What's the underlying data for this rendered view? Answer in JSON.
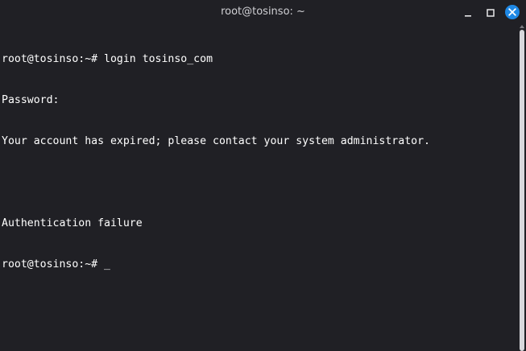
{
  "window": {
    "title": "root@tosinso: ~",
    "colors": {
      "background": "#202025",
      "text": "#ffffff",
      "close_button": "#1e88e5"
    },
    "controls": {
      "minimize_icon": "minimize-icon",
      "maximize_icon": "maximize-icon",
      "close_icon": "close-icon"
    }
  },
  "terminal": {
    "lines": [
      "root@tosinso:~# login tosinso_com",
      "Password:",
      "Your account has expired; please contact your system administrator.",
      "",
      "Authentication failure"
    ],
    "prompt": "root@tosinso:~# ",
    "cursor": "_"
  }
}
